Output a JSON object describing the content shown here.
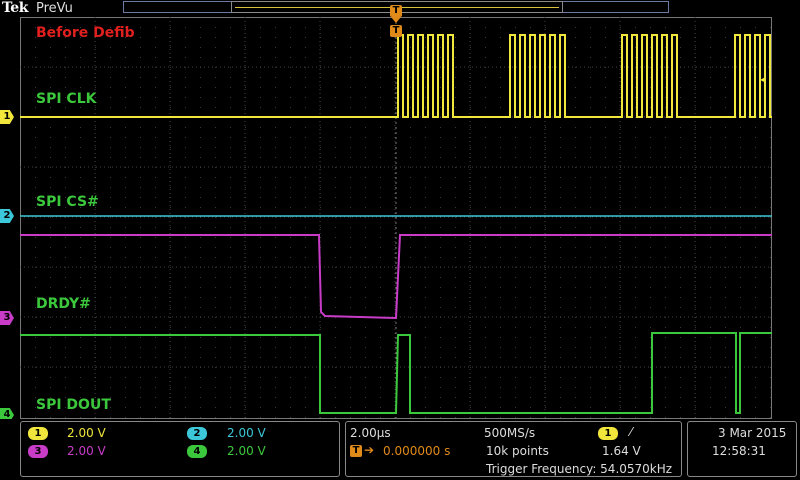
{
  "header": {
    "brand": "Tek",
    "mode": "PreVu"
  },
  "trigger_marker_label": "T",
  "annotation": "Before Defib",
  "channels": [
    {
      "id": "1",
      "label": "SPI CLK",
      "color": "#f0e63c",
      "scale": "2.00 V"
    },
    {
      "id": "2",
      "label": "SPI CS#",
      "color": "#3cc8d8",
      "scale": "2.00 V"
    },
    {
      "id": "3",
      "label": "DRDY#",
      "color": "#c83cc8",
      "scale": "2.00 V"
    },
    {
      "id": "4",
      "label": "SPI DOUT",
      "color": "#3cc83c",
      "scale": "2.00 V"
    }
  ],
  "horizontal": {
    "timebase": "2.00µs",
    "trigger_icon": "T",
    "position": "0.000000 s",
    "sample_rate": "500MS/s",
    "record_length": "10k points",
    "trigger_source": "1",
    "trigger_slope": "rising-edge",
    "trigger_level": "1.64 V",
    "trigger_frequency": "Trigger Frequency: 54.0570kHz"
  },
  "datetime": {
    "date": "3 Mar  2015",
    "time": "12:58:31"
  }
}
